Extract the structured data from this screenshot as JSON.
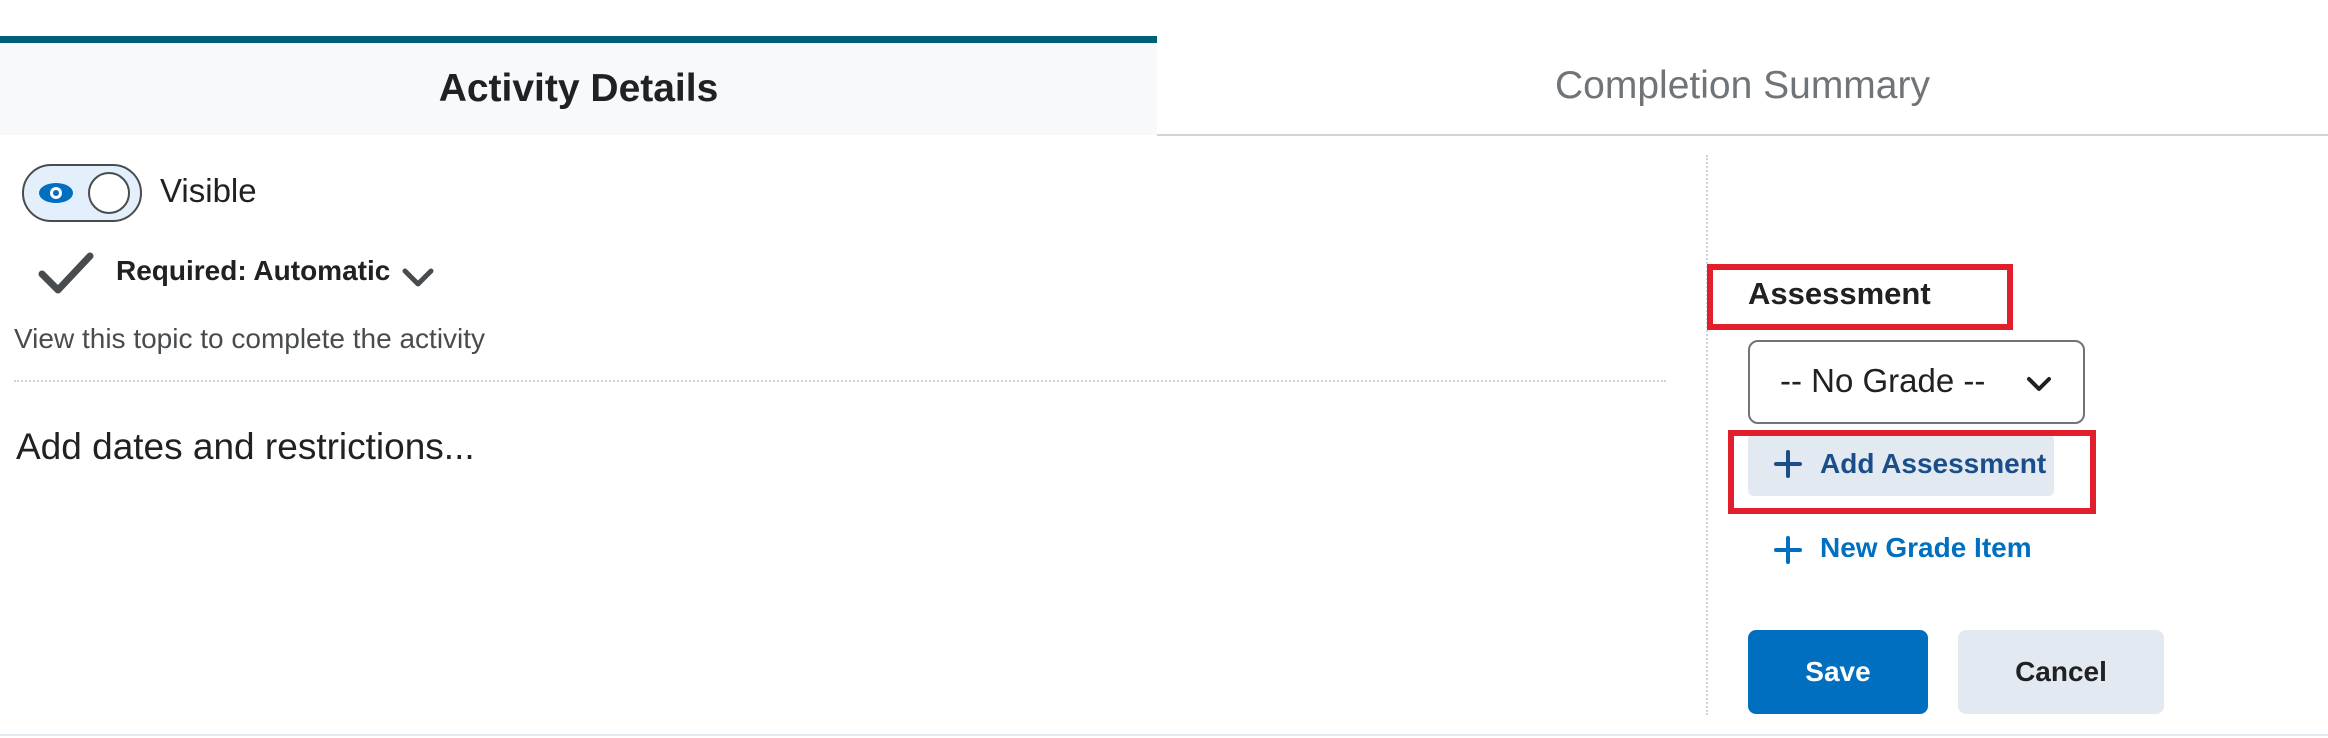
{
  "tabs": [
    {
      "label": "Activity Details",
      "active": true
    },
    {
      "label": "Completion Summary",
      "active": false
    }
  ],
  "visibility": {
    "label": "Visible",
    "on": true,
    "icon": "eye-icon"
  },
  "required": {
    "label": "Required: Automatic",
    "icon": "checkmark-icon"
  },
  "help_text": "View this topic to complete the activity",
  "dates_link": "Add dates and restrictions...",
  "assessment": {
    "heading": "Assessment",
    "grade_select": {
      "value": "-- No Grade --"
    },
    "add_assessment_label": "Add Assessment",
    "new_grade_item_label": "New Grade Item"
  },
  "actions": {
    "save_label": "Save",
    "cancel_label": "Cancel"
  },
  "colors": {
    "accent": "#006fbf",
    "tab_indicator": "#006075",
    "annotation": "#e21e2b",
    "secondary_button": "#e3e9f1"
  }
}
